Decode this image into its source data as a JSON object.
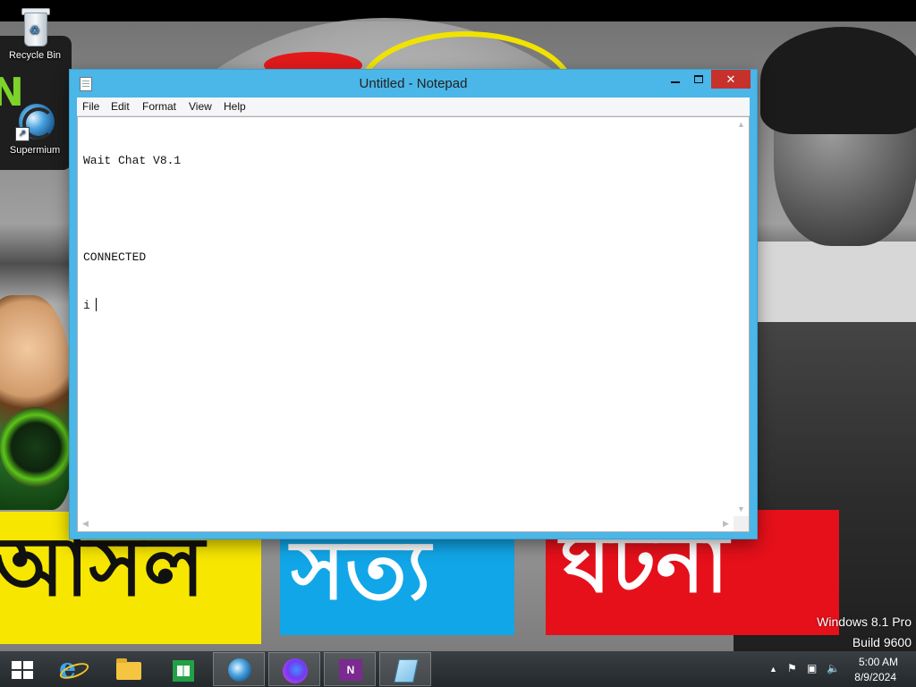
{
  "desktop": {
    "icons": [
      {
        "label": "Recycle Bin",
        "icon": "recycle-bin-icon"
      },
      {
        "label": "Supermium",
        "icon": "supermium-browser-icon"
      }
    ],
    "wallpaper": {
      "banner_left": "আসল",
      "banner_middle": "সত্য",
      "banner_right": "ঘটনা",
      "logo_text": "N",
      "colors": {
        "yellow": "#f7e600",
        "blue": "#11a6e8",
        "red": "#e5101a"
      }
    },
    "watermark": {
      "line1": "Windows 8.1 Pro",
      "line2": "Build 9600"
    }
  },
  "window": {
    "title": "Untitled - Notepad",
    "close_glyph": "✕",
    "accent_color": "#4bb6e8",
    "menu": [
      "File",
      "Edit",
      "Format",
      "View",
      "Help"
    ],
    "content_lines": [
      "Wait Chat V8.1",
      "",
      "CONNECTED",
      "i"
    ]
  },
  "taskbar": {
    "apps": [
      {
        "name": "Internet Explorer",
        "icon": "internet-explorer-icon",
        "active": false
      },
      {
        "name": "File Explorer",
        "icon": "file-explorer-icon",
        "active": false
      },
      {
        "name": "Store",
        "icon": "store-icon",
        "active": false
      },
      {
        "name": "Supermium",
        "icon": "supermium-browser-icon",
        "active": true
      },
      {
        "name": "Firefox",
        "icon": "firefox-icon",
        "active": true
      },
      {
        "name": "OneNote",
        "icon": "onenote-icon",
        "active": true
      },
      {
        "name": "Notepad",
        "icon": "notepad-icon",
        "active": true
      }
    ],
    "onenote_glyph": "N",
    "tray": {
      "chevron": "▲",
      "flag": "⚑",
      "network": "▣",
      "volume": "🔈"
    },
    "clock": {
      "time": "5:00 AM",
      "date": "8/9/2024"
    }
  }
}
